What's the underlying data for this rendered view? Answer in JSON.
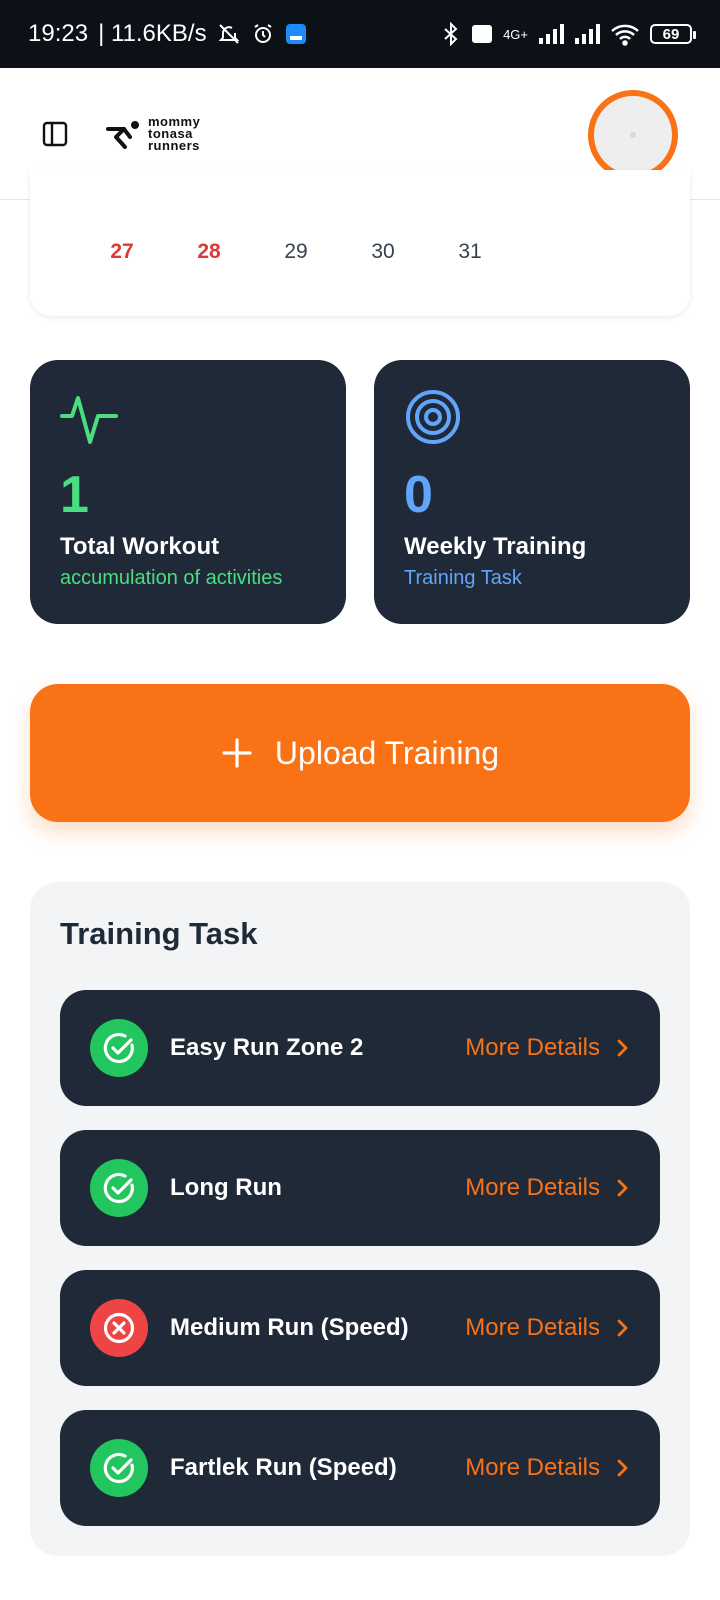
{
  "status_bar": {
    "time": "19:23",
    "speed": "| 11.6KB/s",
    "network": "4G+",
    "battery": "69"
  },
  "app_bar": {
    "logo_lines": [
      "mommy",
      "tonasa",
      "runners"
    ]
  },
  "calendar": {
    "days": [
      {
        "label": "27",
        "highlight": true
      },
      {
        "label": "28",
        "highlight": true
      },
      {
        "label": "29",
        "highlight": false
      },
      {
        "label": "30",
        "highlight": false
      },
      {
        "label": "31",
        "highlight": false
      }
    ]
  },
  "stats": {
    "total_workout": {
      "value": "1",
      "title": "Total Workout",
      "subtitle": "accumulation of activities",
      "accent": "#4ade80"
    },
    "weekly_training": {
      "value": "0",
      "title": "Weekly Training",
      "subtitle": "Training Task",
      "accent": "#60a5fa"
    }
  },
  "upload": {
    "label": "Upload Training",
    "icon": "plus-icon",
    "color": "#f97316"
  },
  "training_task": {
    "heading": "Training Task",
    "link_label": "More Details",
    "items": [
      {
        "name": "Easy Run Zone 2",
        "status": "done",
        "status_icon": "check-circle-icon"
      },
      {
        "name": "Long Run",
        "status": "done",
        "status_icon": "check-circle-icon"
      },
      {
        "name": "Medium Run (Speed)",
        "status": "failed",
        "status_icon": "x-circle-icon"
      },
      {
        "name": "Fartlek Run (Speed)",
        "status": "done",
        "status_icon": "check-circle-icon"
      }
    ]
  },
  "colors": {
    "dark_card": "#1f2937",
    "success": "#22c55e",
    "danger": "#ef4444",
    "brand": "#f97316"
  }
}
